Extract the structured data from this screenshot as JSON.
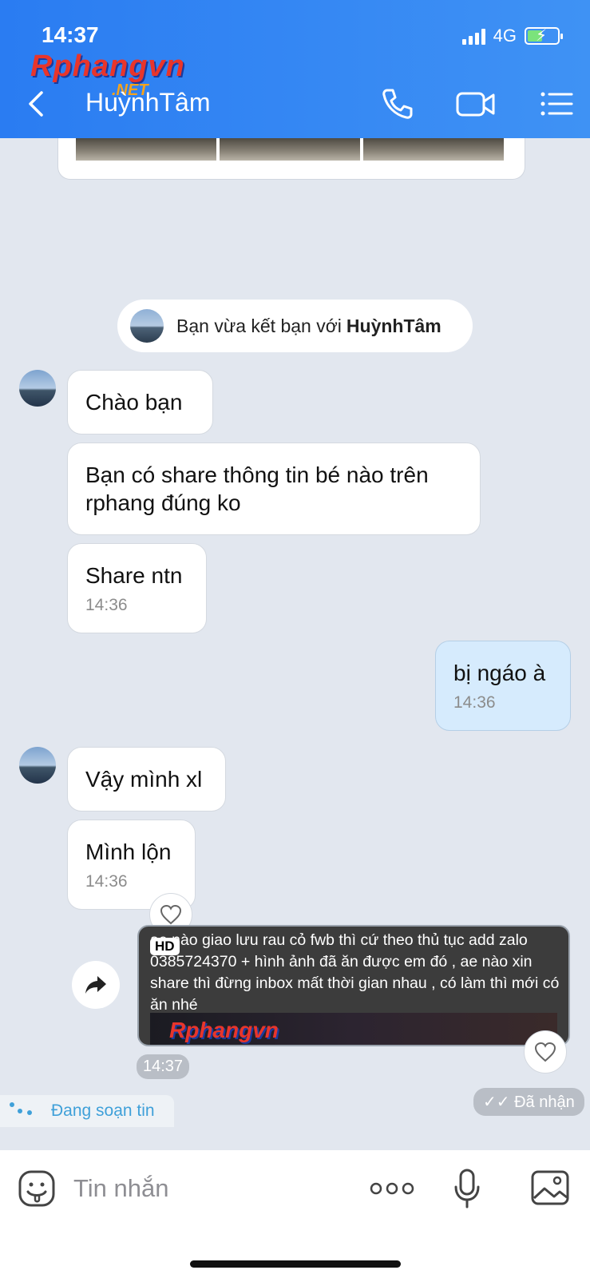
{
  "status": {
    "time": "14:37",
    "network": "4G"
  },
  "watermark": {
    "logo": "Rphangvn",
    "net": ".NET"
  },
  "header": {
    "title": "HuỳnhTâm",
    "back_icon": "chevron-left-icon",
    "call_icon": "phone-icon",
    "video_icon": "video-camera-icon",
    "menu_icon": "list-menu-icon"
  },
  "system_notice": {
    "prefix": "Bạn vừa kết bạn với",
    "name": "HuỳnhTâm"
  },
  "messages": [
    {
      "sender": "them",
      "text": "Chào bạn"
    },
    {
      "sender": "them",
      "text": "Bạn có share thông tin bé nào trên rphang đúng ko"
    },
    {
      "sender": "them",
      "text": "Share ntn",
      "time": "14:36"
    },
    {
      "sender": "me",
      "text": "bị ngáo à",
      "time": "14:36"
    },
    {
      "sender": "them",
      "text": "Vậy mình xl"
    },
    {
      "sender": "them",
      "text": "Mình lộn",
      "time": "14:36"
    }
  ],
  "forwarded_video": {
    "badge": "HD",
    "caption": "ae nào giao lưu rau cỏ fwb thì cứ theo thủ tục add zalo 0385724370 + hình ảnh đã ăn được em đó , ae nào xin share thì đừng inbox mất thời gian nhau , có làm thì mới có ăn nhé",
    "logo": "Rphangvn",
    "time": "14:37"
  },
  "receipt": "Đã nhận",
  "typing_indicator": "Đang soạn tin",
  "composer": {
    "placeholder": "Tin nhắn"
  },
  "colors": {
    "header": "#2a7cf2",
    "my_bubble": "#d6ebfd",
    "background": "#e2e7ef",
    "typing": "#3fa0d9"
  }
}
